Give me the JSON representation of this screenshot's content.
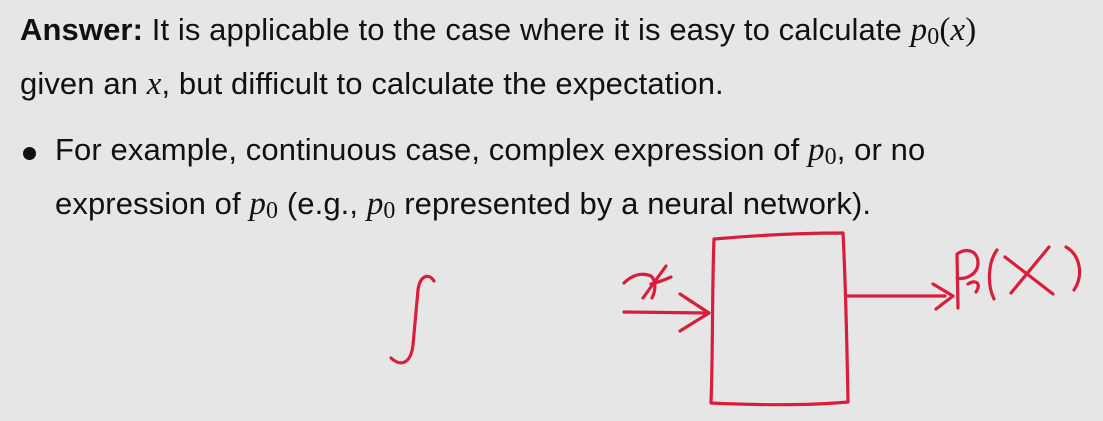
{
  "answer": {
    "label": "Answer:",
    "text_part1": "It is applicable to the case where it is easy to calculate",
    "math_p": "p",
    "math_sub": "0",
    "math_arg_open": "(",
    "math_x": "x",
    "math_arg_close": ")",
    "line2_part1": "given an",
    "line2_x": "x",
    "line2_part2": ", but difficult to calculate the expectation."
  },
  "bullet": {
    "line1_text": "For example, continuous case, complex expression of",
    "line1_p": "p",
    "line1_sub": "0",
    "line1_tail": ", or no",
    "line2_text": "expression of",
    "line2_p": "p",
    "line2_sub": "0",
    "line2_mid": "(e.g.,",
    "line2_p2": "p",
    "line2_sub2": "0",
    "line2_tail": "represented by a neural network)."
  },
  "annotation": {
    "ink_color": "#d81e3c",
    "integral_sign": "∫",
    "input_label": "x",
    "output_label": "P₀(x)"
  },
  "colors": {
    "background": "#e6e6e6",
    "text": "#111111",
    "ink": "#d81e3c"
  }
}
